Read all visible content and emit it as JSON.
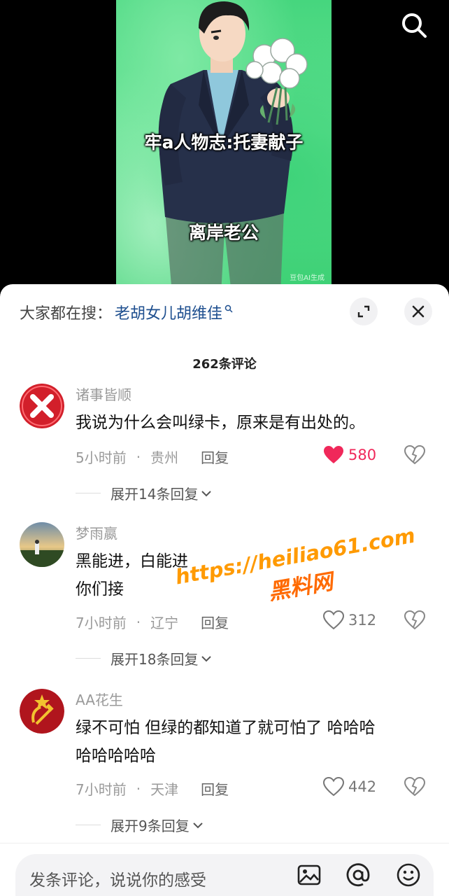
{
  "video": {
    "overlay_line1": "牢a人物志:托妻献子",
    "overlay_line2": "离岸老公",
    "ai_label": "豆包AI生成",
    "search_icon": "search-icon"
  },
  "panel": {
    "search_prefix": "大家都在搜：",
    "search_term": "老胡女儿胡维佳",
    "expand_icon": "expand-icon",
    "close_icon": "close-icon",
    "comment_count": "262条评论"
  },
  "comments": [
    {
      "username": "诸事皆顺",
      "text": "我说为什么会叫绿卡，原来是有出处的。",
      "time": "5小时前",
      "location": "贵州",
      "reply": "回复",
      "likes": "580",
      "liked": true,
      "expand": "展开14条回复"
    },
    {
      "username": "梦雨嬴",
      "text_line1": "黑能进，白能进",
      "text_line2": "你们接",
      "time": "7小时前",
      "location": "辽宁",
      "reply": "回复",
      "likes": "312",
      "liked": false,
      "expand": "展开18条回复"
    },
    {
      "username": "AA花生",
      "text_line1": "绿不可怕 但绿的都知道了就可怕了 哈哈哈",
      "text_line2": "哈哈哈哈哈",
      "time": "7小时前",
      "location": "天津",
      "reply": "回复",
      "likes": "442",
      "liked": false,
      "expand": "展开9条回复"
    }
  ],
  "input": {
    "placeholder": "发条评论，说说你的感受",
    "icons": [
      "image-icon",
      "at-icon",
      "emoji-icon"
    ]
  },
  "watermark": {
    "line1": "https://heiliao61.com",
    "line2": "黑料网"
  },
  "colors": {
    "like_active": "#f0285a",
    "search_term": "#1e4f8f",
    "video_green": "#46d67e"
  }
}
